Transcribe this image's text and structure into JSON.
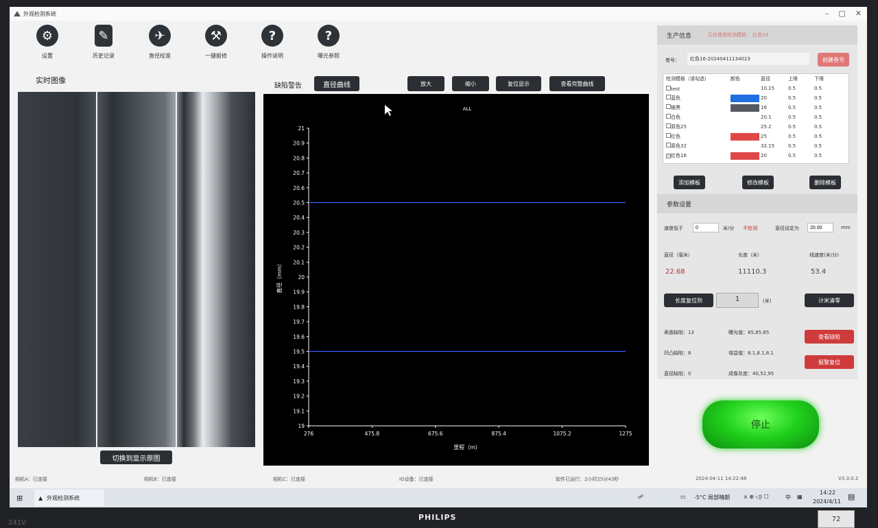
{
  "window": {
    "title": "外观检测系统"
  },
  "toolbar": [
    {
      "label": "设置",
      "icon": "gear-icon",
      "glyph": "⚙"
    },
    {
      "label": "历史记录",
      "icon": "history-icon",
      "glyph": "✎"
    },
    {
      "label": "直径校准",
      "icon": "pin-icon",
      "glyph": "✈"
    },
    {
      "label": "一键报修",
      "icon": "wrench-icon",
      "glyph": "⚒"
    },
    {
      "label": "操作说明",
      "icon": "help-icon",
      "glyph": "?"
    },
    {
      "label": "曝光参照",
      "icon": "help-icon",
      "glyph": "?"
    }
  ],
  "realtime": {
    "title": "实时图像",
    "switch_button": "切换到显示原图"
  },
  "chart_panel": {
    "tab_defect": "缺陷警告",
    "tab_diameter": "直径曲线",
    "zoom_in": "放大",
    "zoom_out": "缩小",
    "reset_view": "复位显示",
    "view_full": "查看完整曲线"
  },
  "chart_data": {
    "type": "line",
    "title": "ALL",
    "xlabel": "里程（m）",
    "ylabel": "直径（mm）",
    "xlim": [
      276,
      1275
    ],
    "ylim": [
      19,
      21
    ],
    "xticks": [
      "276",
      "475.8",
      "675.6",
      "875.4",
      "1075.2",
      "1275"
    ],
    "yticks": [
      "19",
      "19.1",
      "19.2",
      "19.3",
      "19.4",
      "19.5",
      "19.6",
      "19.7",
      "19.8",
      "19.9",
      "20",
      "20.1",
      "20.2",
      "20.3",
      "20.4",
      "20.5",
      "20.6",
      "20.7",
      "20.8",
      "20.9",
      "21"
    ],
    "series": [
      {
        "x": [
          276,
          1275
        ],
        "values": [
          20.5,
          20.5
        ],
        "color": "#3a5cff"
      },
      {
        "x": [
          276,
          1275
        ],
        "values": [
          19.5,
          19.5
        ],
        "color": "#3a5cff"
      }
    ],
    "grid": false
  },
  "production": {
    "title": "生产信息",
    "template_in_use": "正在使用检测模板：  红色16",
    "roll_label": "卷号：",
    "roll_value": "红色16-20240411134023",
    "create_roll": "创建卷号",
    "table_headers": [
      "检测模板（请勾选）",
      "颜色",
      "直径",
      "上限",
      "下限"
    ],
    "templates": [
      {
        "name": "test",
        "color": "#ffffff",
        "diameter": "10.15",
        "upper": "0.5",
        "lower": "0.5",
        "checked": ""
      },
      {
        "name": "蓝色",
        "color": "#1f6fe0",
        "diameter": "20",
        "upper": "0.5",
        "lower": "0.5",
        "checked": ""
      },
      {
        "name": "银黑",
        "color": "#555a60",
        "diameter": "16",
        "upper": "0.5",
        "lower": "0.5",
        "checked": ""
      },
      {
        "name": "白色",
        "color": "#ffffff",
        "diameter": "20.1",
        "upper": "0.5",
        "lower": "0.5",
        "checked": ""
      },
      {
        "name": "原色25",
        "color": "#ffffff",
        "diameter": "25.2",
        "upper": "0.5",
        "lower": "0.5",
        "checked": ""
      },
      {
        "name": "红色",
        "color": "#e04848",
        "diameter": "25",
        "upper": "0.5",
        "lower": "0.5",
        "checked": ""
      },
      {
        "name": "原色32",
        "color": "#ffffff",
        "diameter": "32.15",
        "upper": "0.5",
        "lower": "0.5",
        "checked": ""
      },
      {
        "name": "红色16",
        "color": "#e04848",
        "diameter": "20",
        "upper": "0.5",
        "lower": "0.5",
        "checked": "✓"
      }
    ],
    "add_template": "添加模板",
    "edit_template": "修改模板",
    "delete_template": "删除模板"
  },
  "params": {
    "title": "参数设置",
    "speed_below": "速度低于",
    "speed_value": "0",
    "speed_unit": "米/分",
    "no_detect": "不检测",
    "diameter_set": "直径设定为",
    "diameter_value": "20.00",
    "diameter_unit": "mm",
    "col_diameter": "直径（毫米）",
    "col_length": "长度（米）",
    "col_speed": "线速度(米/分)",
    "val_diameter": "22.68",
    "val_length": "11110.3",
    "val_speed": "53.4",
    "reset_length": "长度复位到",
    "reset_value": "1",
    "meter_unit": "(米)",
    "meter_zero": "计米清零",
    "surface_defects": "表面缺陷：13",
    "exposure": "曝光值：85,85,85",
    "bump_defects": "凹凸缺陷：8",
    "gain": "增益值：8.1,8.1,8.1",
    "diameter_defects": "直径缺陷：0",
    "gray": "成像灰度：40,52,95",
    "view_defects": "查看缺陷",
    "alarm_reset": "报警复位"
  },
  "stop_button": "停止",
  "status": {
    "camA": "相机A：已连接",
    "camB": "相机B：已连接",
    "camC": "相机C：已连接",
    "io": "IO设备：已连接",
    "runtime": "软件已运行：2小时25分43秒",
    "datetime": "2024-04-11 14:22:48",
    "version": "V3.3.0.2"
  },
  "taskbar": {
    "app": "外观检测系统",
    "weather": "-5°C 局部晴朗",
    "ime": "中",
    "time": "14:22",
    "date": "2024/4/11"
  },
  "monitor": {
    "brand": "PHILIPS",
    "model": "241V",
    "sticker": "72"
  }
}
